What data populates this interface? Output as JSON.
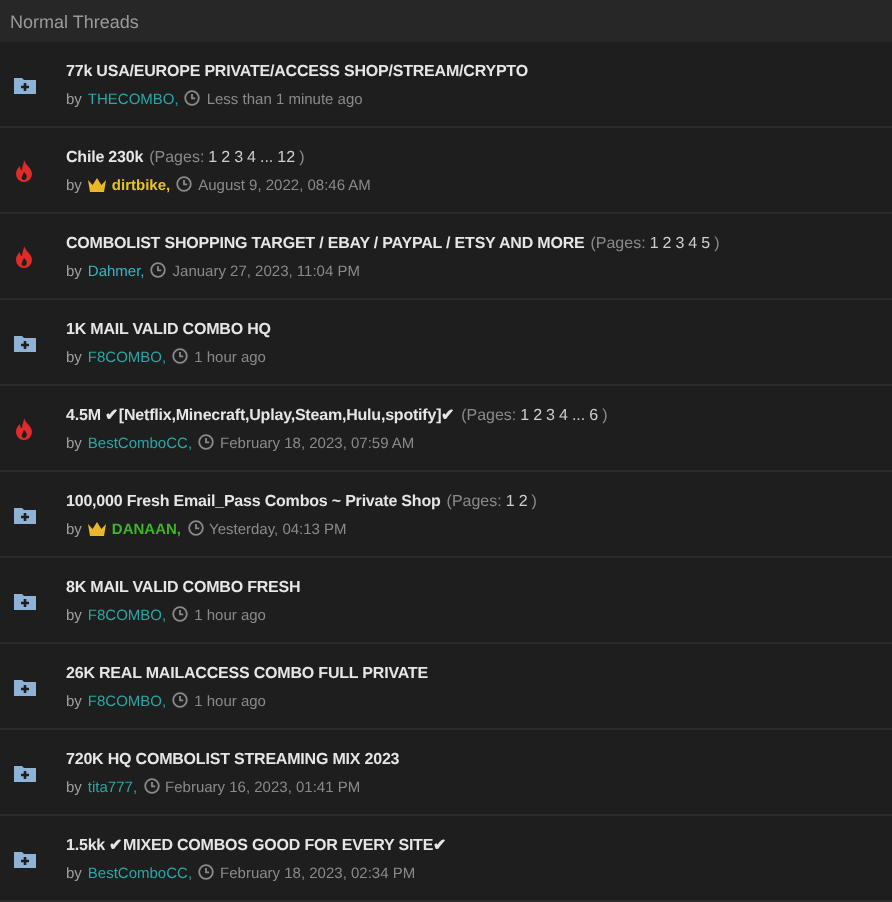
{
  "section": {
    "title": "Normal Threads"
  },
  "threads": [
    {
      "kind": "folder",
      "title": "77k USA/EUROPE PRIVATE/ACCESS SHOP/STREAM/CRYPTO",
      "by": "by",
      "crown": false,
      "author": "THECOMBO,",
      "color": "#2aa6a6",
      "time": "Less than 1 minute ago"
    },
    {
      "kind": "hot",
      "title": "Chile 230k",
      "pages": {
        "label": "(Pages:",
        "links": [
          "1",
          "2",
          "3",
          "4",
          "...",
          "12"
        ],
        "close": ")"
      },
      "by": "by",
      "crown": true,
      "author": "dirtbike,",
      "color": "#e8c22a",
      "time": "August 9, 2022, 08:46 AM"
    },
    {
      "kind": "hot",
      "title": "COMBOLIST SHOPPING TARGET / EBAY / PAYPAL / ETSY AND MORE",
      "pages": {
        "label": "(Pages:",
        "links": [
          "1",
          "2",
          "3",
          "4",
          "5"
        ],
        "close": ")"
      },
      "by": "by",
      "crown": false,
      "author": "Dahmer,",
      "color": "#36b7c4",
      "time": "January 27, 2023, 11:04 PM"
    },
    {
      "kind": "folder",
      "title": "1K MAIL VALID COMBO HQ",
      "by": "by",
      "crown": false,
      "author": "F8COMBO,",
      "color": "#2aa6a6",
      "time": "1 hour ago"
    },
    {
      "kind": "hot",
      "title": "4.5M ✔[Netflix,Minecraft,Uplay,Steam,Hulu,spotify]✔",
      "pages": {
        "label": "(Pages:",
        "links": [
          "1",
          "2",
          "3",
          "4",
          "...",
          "6"
        ],
        "close": ")"
      },
      "by": "by",
      "crown": false,
      "author": "BestComboCC,",
      "color": "#2aa6a6",
      "time": "February 18, 2023, 07:59 AM"
    },
    {
      "kind": "folder",
      "title": "100,000 Fresh Email_Pass Combos ~ Private Shop",
      "pages": {
        "label": "(Pages:",
        "links": [
          "1",
          "2"
        ],
        "close": ")"
      },
      "by": "by",
      "crown": true,
      "author": "DANAAN,",
      "color": "#3fb52a",
      "time": "Yesterday, 04:13 PM"
    },
    {
      "kind": "folder",
      "title": "8K MAIL VALID COMBO FRESH",
      "by": "by",
      "crown": false,
      "author": "F8COMBO,",
      "color": "#2aa6a6",
      "time": "1 hour ago"
    },
    {
      "kind": "folder",
      "title": "26K REAL MAILACCESS COMBO FULL PRIVATE",
      "by": "by",
      "crown": false,
      "author": "F8COMBO,",
      "color": "#2aa6a6",
      "time": "1 hour ago"
    },
    {
      "kind": "folder",
      "title": "720K HQ COMBOLIST STREAMING MIX 2023",
      "by": "by",
      "crown": false,
      "author": "tita777,",
      "color": "#2aa6a6",
      "time": "February 16, 2023, 01:41 PM"
    },
    {
      "kind": "folder",
      "title": "1.5kk ✔MIXED COMBOS GOOD FOR EVERY SITE✔",
      "by": "by",
      "crown": false,
      "author": "BestComboCC,",
      "color": "#2aa6a6",
      "time": "February 18, 2023, 02:34 PM"
    }
  ]
}
